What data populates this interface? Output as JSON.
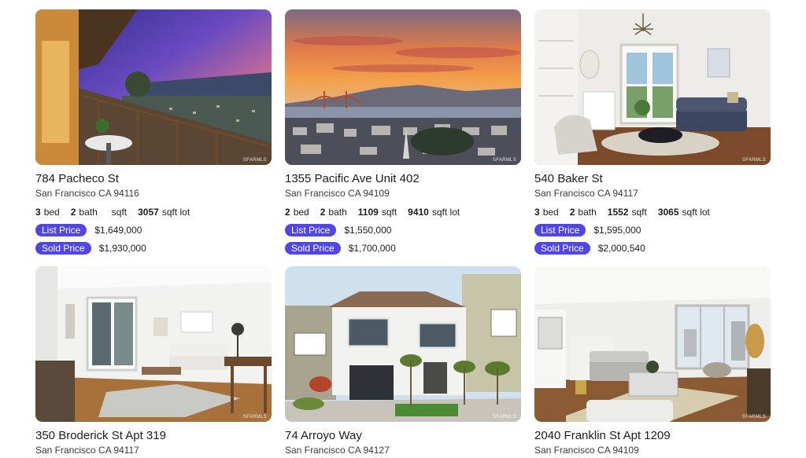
{
  "listings": [
    {
      "address": "784 Pacheco St",
      "city": "San Francisco CA 94116",
      "beds": "3",
      "beds_label": "bed",
      "baths": "2",
      "baths_label": "bath",
      "sqft": "",
      "sqft_label": "sqft",
      "lot": "3057",
      "lot_label": "sqft lot",
      "list_label": "List Price",
      "list_price": "$1,649,000",
      "sold_label": "Sold Price",
      "sold_price": "$1,930,000",
      "watermark": "SFARMLS"
    },
    {
      "address": "1355 Pacific Ave Unit 402",
      "city": "San Francisco CA 94109",
      "beds": "2",
      "beds_label": "bed",
      "baths": "2",
      "baths_label": "bath",
      "sqft": "1109",
      "sqft_label": "sqft",
      "lot": "9410",
      "lot_label": "sqft lot",
      "list_label": "List Price",
      "list_price": "$1,550,000",
      "sold_label": "Sold Price",
      "sold_price": "$1,700,000",
      "watermark": "SFARMLS"
    },
    {
      "address": "540 Baker St",
      "city": "San Francisco CA 94117",
      "beds": "3",
      "beds_label": "bed",
      "baths": "2",
      "baths_label": "bath",
      "sqft": "1552",
      "sqft_label": "sqft",
      "lot": "3065",
      "lot_label": "sqft lot",
      "list_label": "List Price",
      "list_price": "$1,595,000",
      "sold_label": "Sold Price",
      "sold_price": "$2,000,540",
      "watermark": "SFARMLS"
    },
    {
      "address": "350 Broderick St Apt 319",
      "city": "San Francisco CA 94117",
      "watermark": "SFARMLS"
    },
    {
      "address": "74 Arroyo Way",
      "city": "San Francisco CA 94127",
      "watermark": "SFARMLS"
    },
    {
      "address": "2040 Franklin St Apt 1209",
      "city": "San Francisco CA 94109",
      "watermark": "SFARMLS"
    }
  ],
  "colors": {
    "pill": "#4f46e5"
  }
}
